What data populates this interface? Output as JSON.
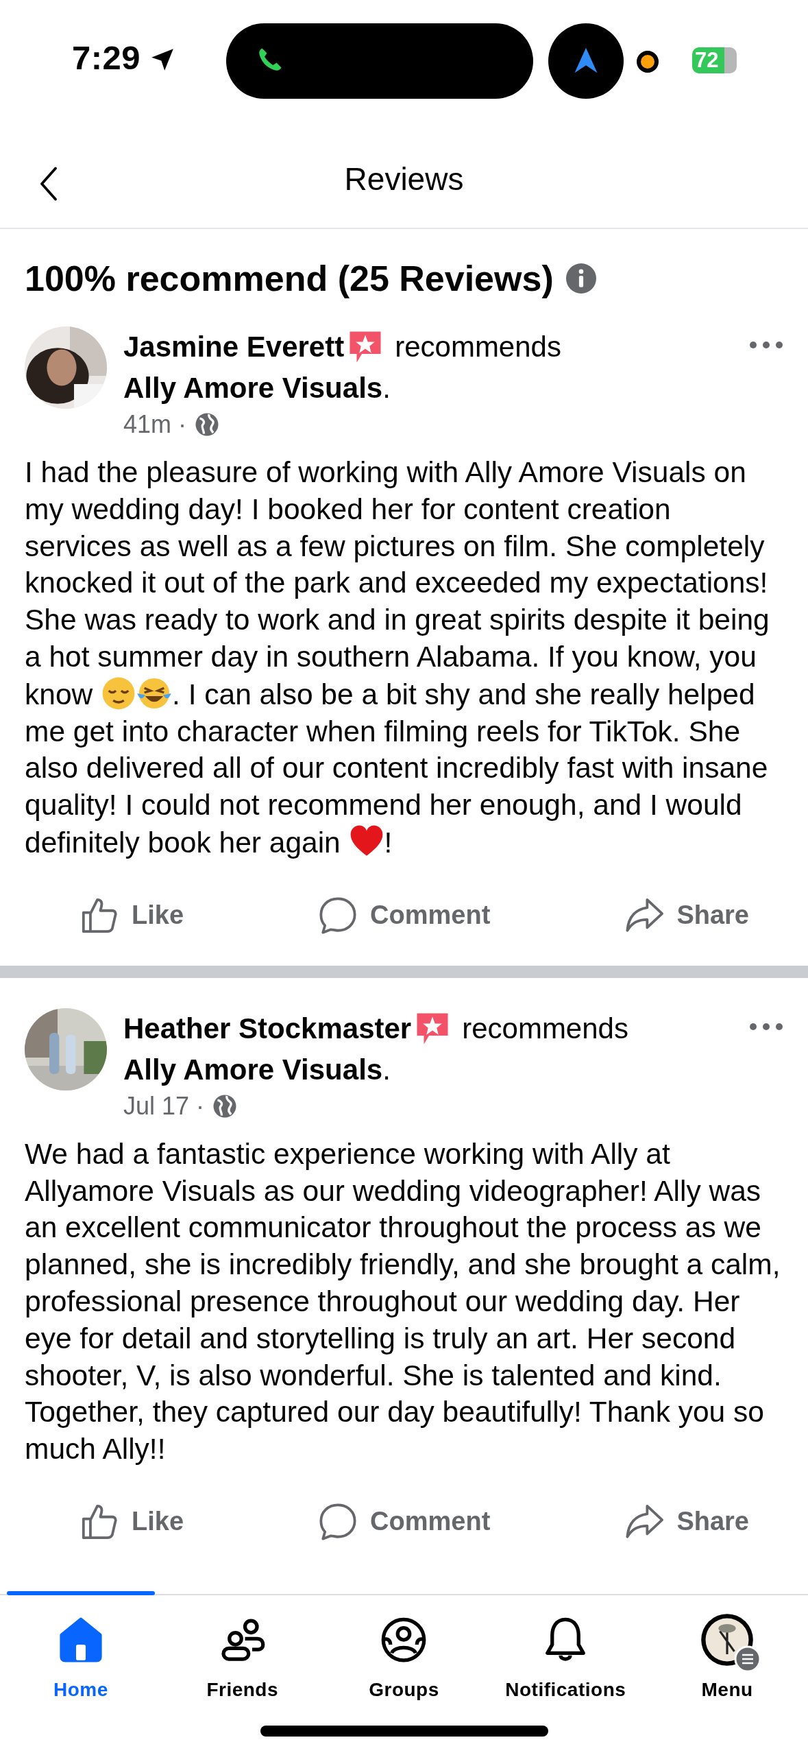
{
  "status_bar": {
    "time": "7:29",
    "battery": "72"
  },
  "header": {
    "title": "Reviews"
  },
  "summary": {
    "title": "100% recommend (25 Reviews)"
  },
  "reviews": [
    {
      "author": "Jasmine Everett",
      "verb": "recommends",
      "page": "**Ally Amore Visuals**.",
      "time": "41m ·",
      "body": [
        {
          "kind": "text",
          "text": "I had the pleasure of working with Ally Amore Visuals on my wedding day! I booked her for content creation services as well as a few pictures on film. She completely knocked it out of the park and exceeded my expectations! She was ready to work and in great spirits despite it being a hot summer day in southern Alabama. If you know, you know "
        },
        {
          "kind": "relieved"
        },
        {
          "kind": "joy"
        },
        {
          "kind": "text",
          "text": ". I can also be a bit shy and she really helped me get into character when filming reels for TikTok. She also delivered all of our content incredibly fast with insane quality! I could not recommend her enough, and I would definitely book her again "
        },
        {
          "kind": "heart"
        },
        {
          "kind": "text",
          "text": "!"
        }
      ],
      "actions": [
        "Like",
        "Comment",
        "Share"
      ]
    },
    {
      "author": "Heather Stockmaster",
      "verb": "recommends",
      "page": "**Ally Amore Visuals**.",
      "time": "Jul 17 ·",
      "body": [
        {
          "kind": "text",
          "text": "We had a fantastic experience working with Ally at Allyamore Visuals as our wedding videographer! Ally was an excellent communicator throughout the process as we planned, she is incredibly friendly, and she brought a calm, professional presence throughout our wedding day. Her eye for detail and storytelling is truly an art. Her second shooter, V, is also wonderful. She is talented and kind. Together, they captured our day beautifully! Thank you so much Ally!!"
        }
      ],
      "actions": [
        "Like",
        "Comment",
        "Share"
      ]
    }
  ],
  "tab_bar": [
    {
      "label": "Home",
      "selected": true
    },
    {
      "label": "Friends",
      "selected": false
    },
    {
      "label": "Groups",
      "selected": false
    },
    {
      "label": "Notifications",
      "selected": false
    },
    {
      "label": "Menu",
      "selected": false
    }
  ]
}
